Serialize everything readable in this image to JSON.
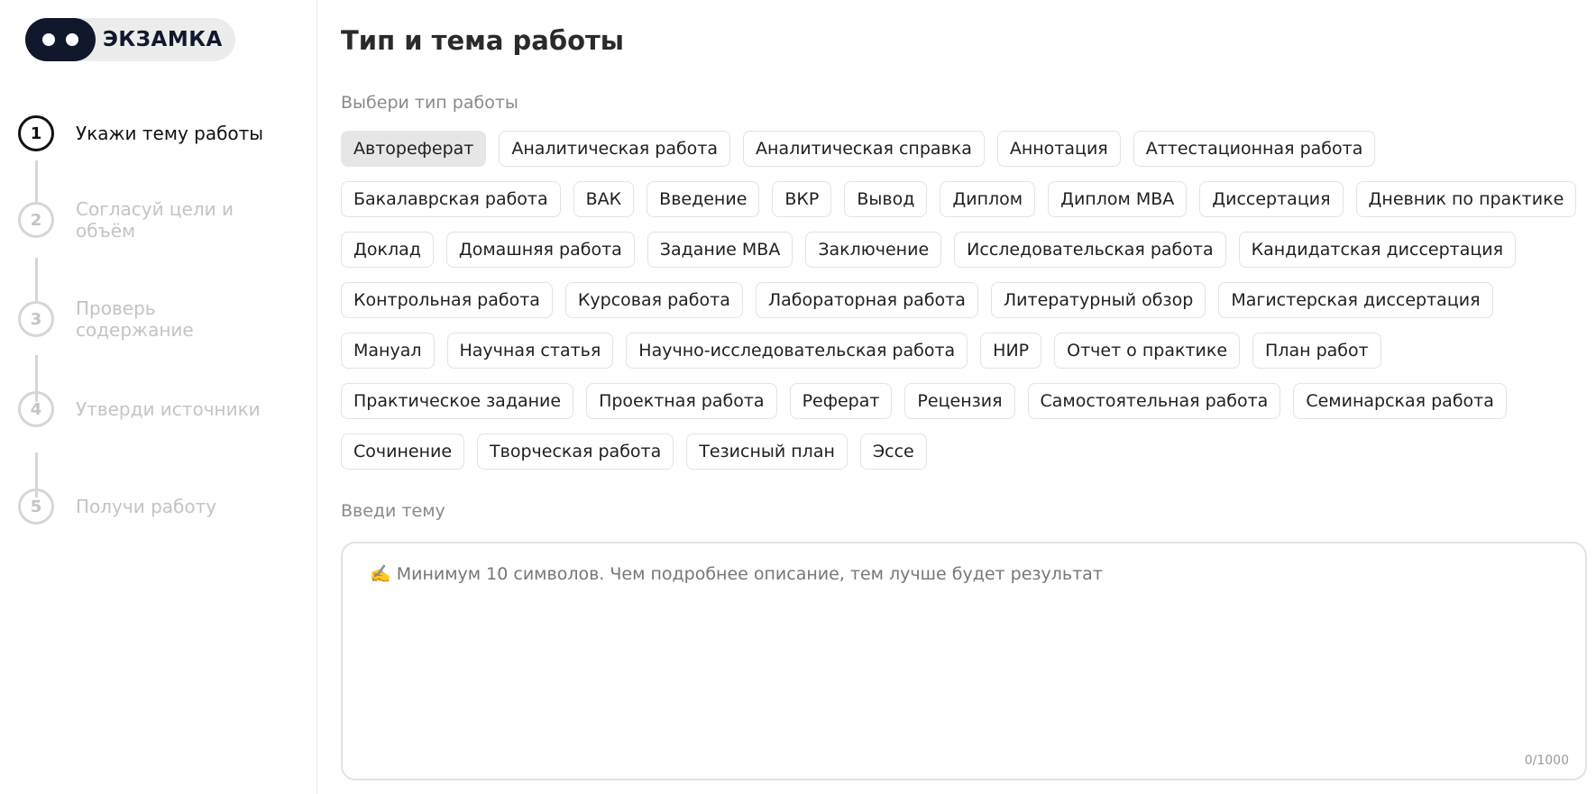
{
  "brand": {
    "name": "ЭКЗАМКА"
  },
  "steps": [
    {
      "num": "1",
      "label": "Укажи тему работы",
      "active": true
    },
    {
      "num": "2",
      "label": "Согласуй цели и объём",
      "active": false
    },
    {
      "num": "3",
      "label": "Проверь содержание",
      "active": false
    },
    {
      "num": "4",
      "label": "Утверди источники",
      "active": false
    },
    {
      "num": "5",
      "label": "Получи работу",
      "active": false
    }
  ],
  "main": {
    "title": "Тип и тема работы",
    "type_label": "Выбери тип работы",
    "selected_type": "Автореферат",
    "work_types": [
      "Автореферат",
      "Аналитическая работа",
      "Аналитическая справка",
      "Аннотация",
      "Аттестационная работа",
      "Бакалаврская работа",
      "ВАК",
      "Введение",
      "ВКР",
      "Вывод",
      "Диплом",
      "Диплом MBA",
      "Диссертация",
      "Дневник по практике",
      "Доклад",
      "Домашняя работа",
      "Задание MBA",
      "Заключение",
      "Исследовательская работа",
      "Кандидатская диссертация",
      "Контрольная работа",
      "Курсовая работа",
      "Лабораторная работа",
      "Литературный обзор",
      "Магистерская диссертация",
      "Мануал",
      "Научная статья",
      "Научно-исследовательская работа",
      "НИР",
      "Отчет о практике",
      "План работ",
      "Практическое задание",
      "Проектная работа",
      "Реферат",
      "Рецензия",
      "Самостоятельная работа",
      "Семинарская работа",
      "Сочинение",
      "Творческая работа",
      "Тезисный план",
      "Эссе"
    ],
    "topic_label": "Введи тему",
    "topic_value": "",
    "topic_placeholder": "✍️ Минимум 10 символов. Чем подробнее описание, тем лучше будет результат",
    "counter": "0/1000"
  }
}
